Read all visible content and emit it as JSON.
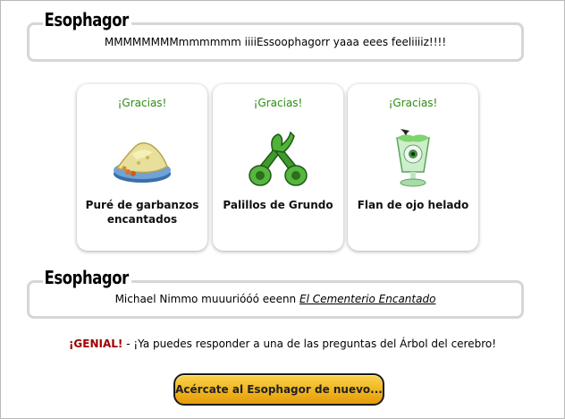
{
  "dialog_top": {
    "speaker": "Esophagor",
    "text": "MMMMMMMMmmmmmm iiiiEssoophagorr yaaa eees feeliiiiz!!!!"
  },
  "items": [
    {
      "thanks": "¡Gracias!",
      "name": "Puré de garbanzos encantados",
      "icon": "mashed-chickpeas-icon"
    },
    {
      "thanks": "¡Gracias!",
      "name": "Palillos de Grundo",
      "icon": "grundo-sticks-icon"
    },
    {
      "thanks": "¡Gracias!",
      "name": "Flan de ojo helado",
      "icon": "eyeball-flan-icon"
    }
  ],
  "dialog_bottom": {
    "speaker": "Esophagor",
    "text_before": "Michael Nimmo muuurióóó eeenn ",
    "place": "El Cementerio Encantado"
  },
  "notice": {
    "emphasis": "¡GENIAL!",
    "text": " - ¡Ya puedes responder a una de las preguntas del Árbol del cerebro!"
  },
  "action_button": {
    "label": "Acércate al Esophagor de nuevo..."
  },
  "colors": {
    "thanks": "#2e8b12",
    "genial": "#a00000",
    "button": "#f0b51f",
    "box_border": "#d6d6d6"
  }
}
